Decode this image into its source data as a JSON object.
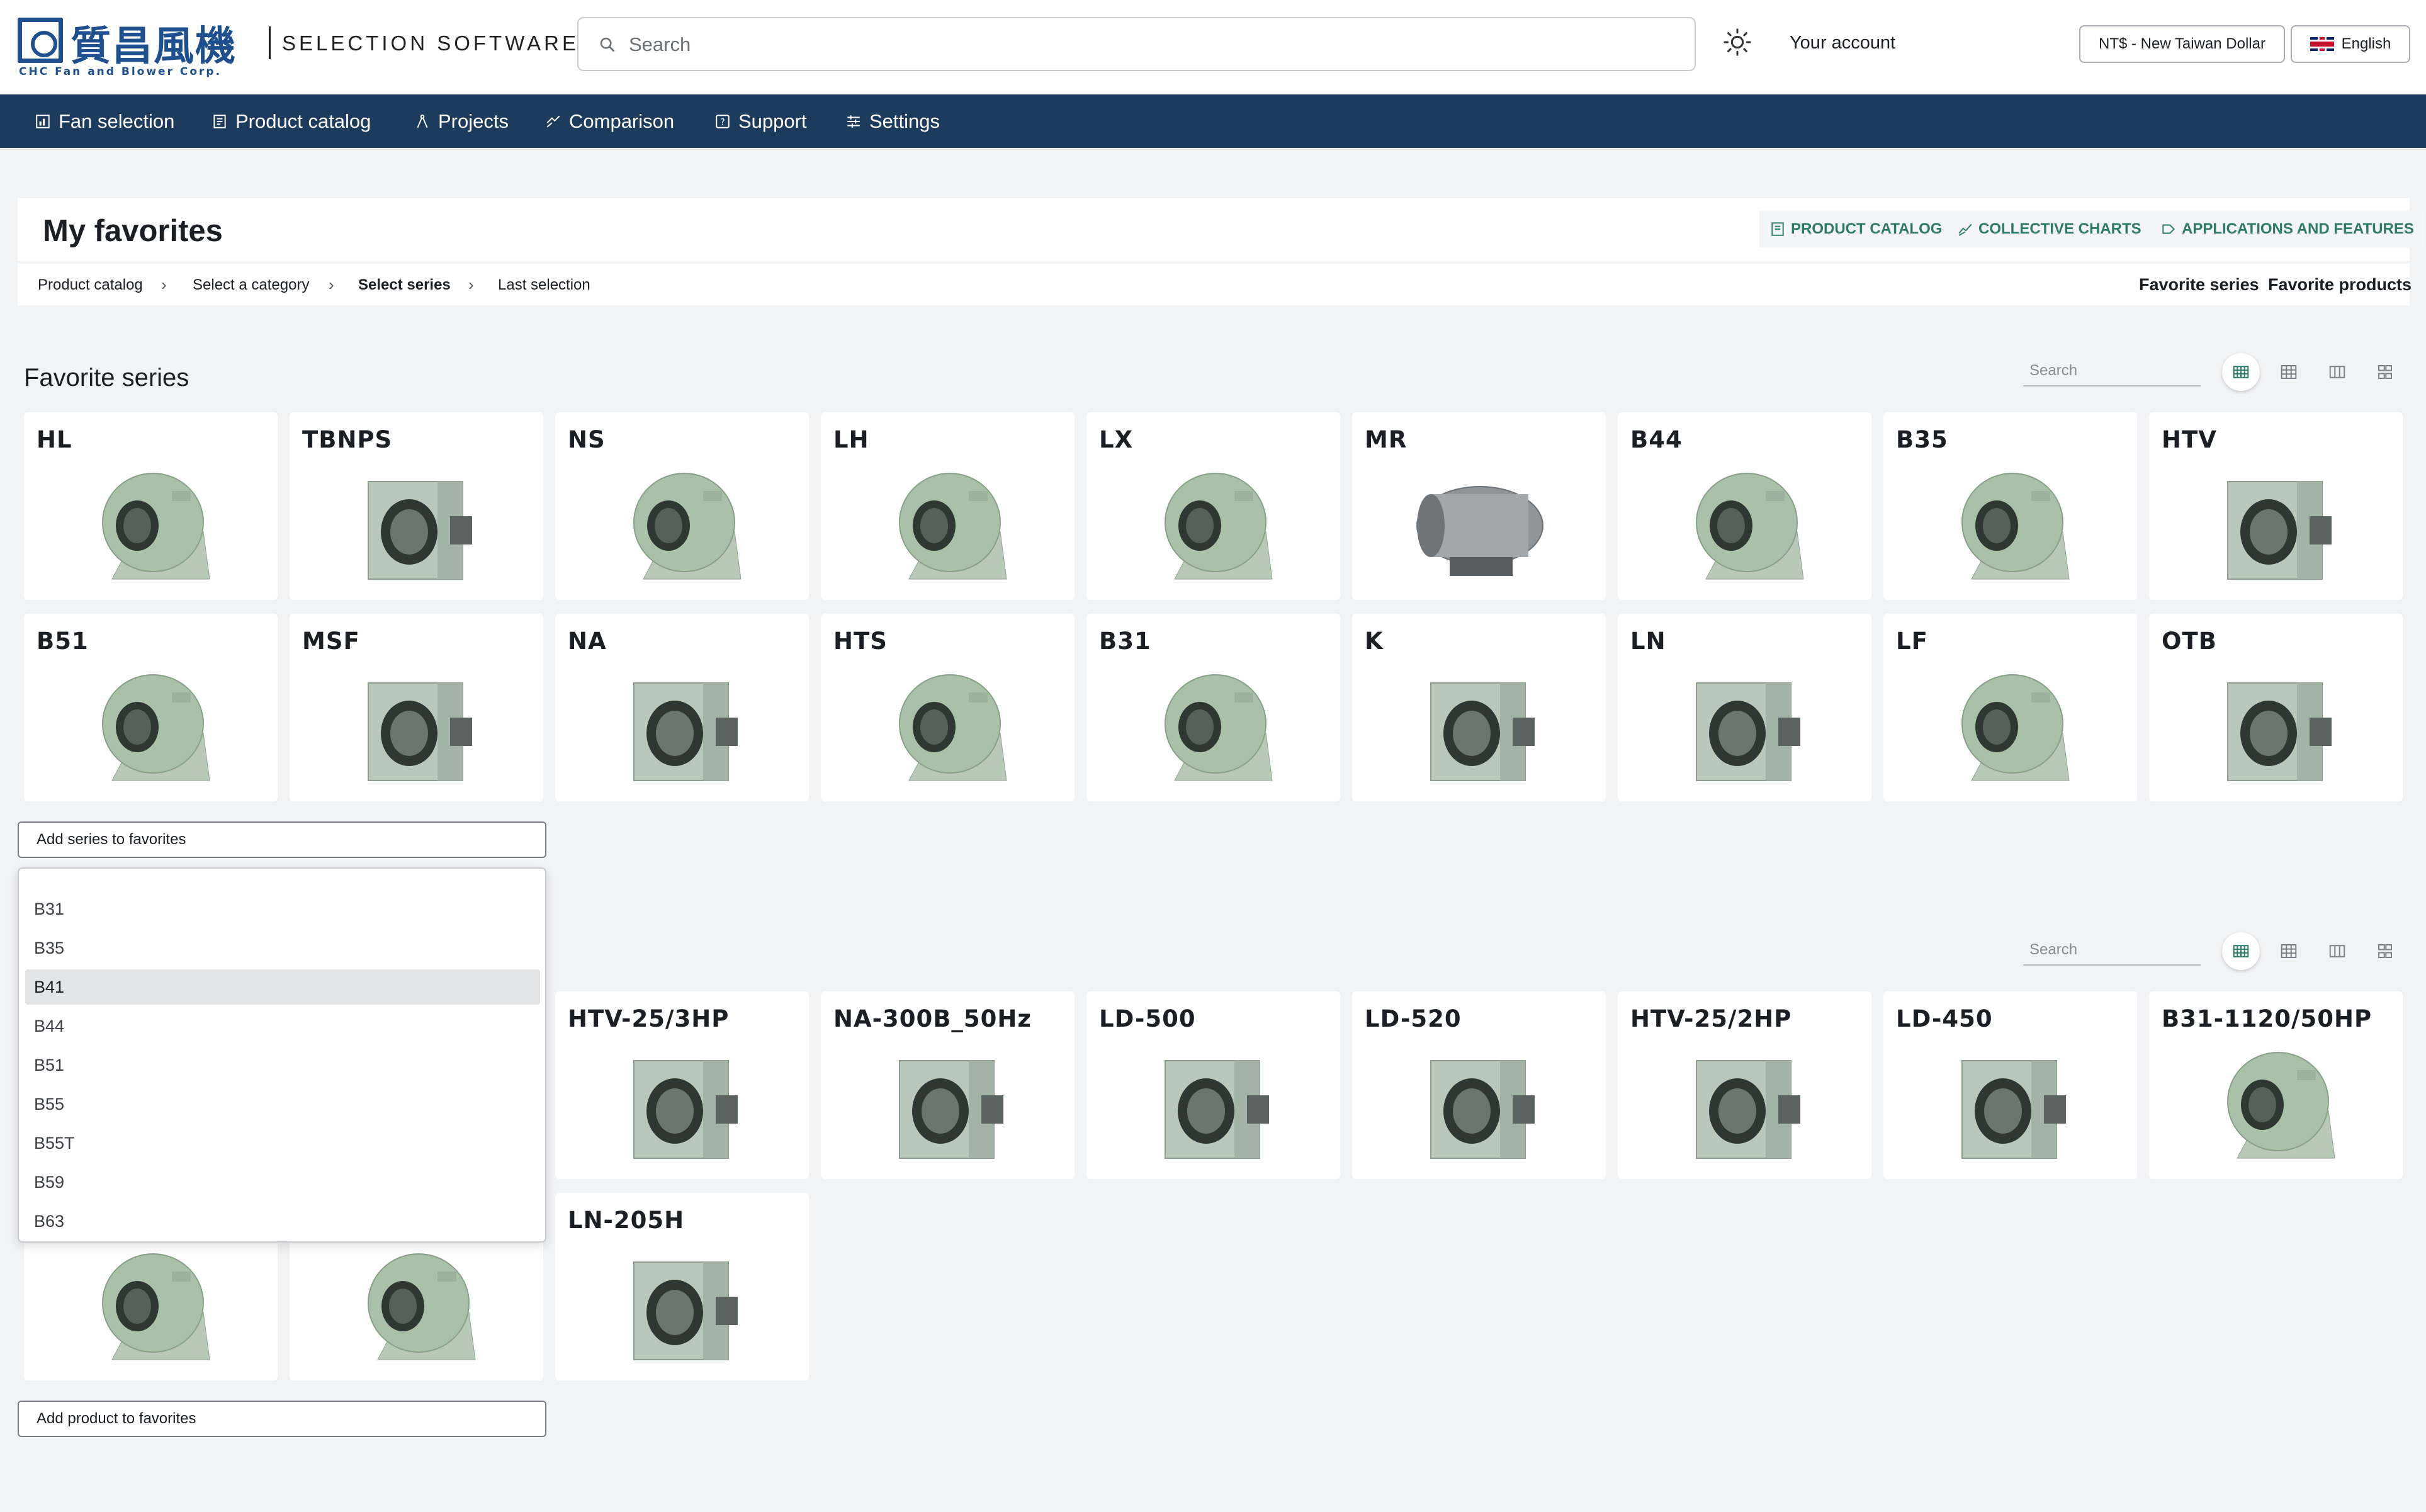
{
  "brand": {
    "logo_cn": "質昌風機",
    "logo_en": "CHC Fan and Blower Corp.",
    "title": "SELECTION SOFTWARE"
  },
  "header": {
    "search_placeholder": "Search",
    "theme_icon": "sun-icon",
    "account": "Your account",
    "currency": "NT$ - New Taiwan Dollar",
    "language": "English"
  },
  "nav": [
    {
      "label": "Fan selection",
      "icon": "fan-selection-icon"
    },
    {
      "label": "Product catalog",
      "icon": "catalog-icon"
    },
    {
      "label": "Projects",
      "icon": "compass-icon"
    },
    {
      "label": "Comparison",
      "icon": "compare-icon"
    },
    {
      "label": "Support",
      "icon": "help-icon"
    },
    {
      "label": "Settings",
      "icon": "sliders-icon"
    }
  ],
  "page": {
    "title": "My favorites",
    "actions": [
      "Product catalog",
      "Collective charts",
      "Applications and features"
    ],
    "breadcrumb": [
      "Product catalog",
      "Select a category",
      "Select series",
      "Last selection"
    ],
    "tabs": [
      "Favorite series",
      "Favorite products"
    ]
  },
  "series_section": {
    "title": "Favorite series",
    "search_placeholder": "Search",
    "cards": [
      "HL",
      "TBNPS",
      "NS",
      "LH",
      "LX",
      "MR",
      "B44",
      "B35",
      "HTV",
      "B51",
      "MSF",
      "NA",
      "HTS",
      "B31",
      "K",
      "LN",
      "LF",
      "OTB"
    ],
    "add_value": "Add series to favorites"
  },
  "dropdown": {
    "options": [
      "B31",
      "B35",
      "B41",
      "B44",
      "B51",
      "B55",
      "B55T",
      "B59",
      "B63"
    ],
    "highlighted": "B41"
  },
  "products_section": {
    "search_placeholder": "Search",
    "cards": [
      "HTV-25/3HP",
      "NA-300B_50Hz",
      "LD-500",
      "LD-520",
      "HTV-25/2HP",
      "LD-450",
      "B31-1120/50HP",
      "LN-205H"
    ],
    "add_placeholder": "Add product to favorites"
  },
  "colors": {
    "nav_bg": "#1d3b5c",
    "brand_blue": "#1e4f8f",
    "accent_green": "#2c7a67",
    "fan_green": "#a9c1a9"
  }
}
